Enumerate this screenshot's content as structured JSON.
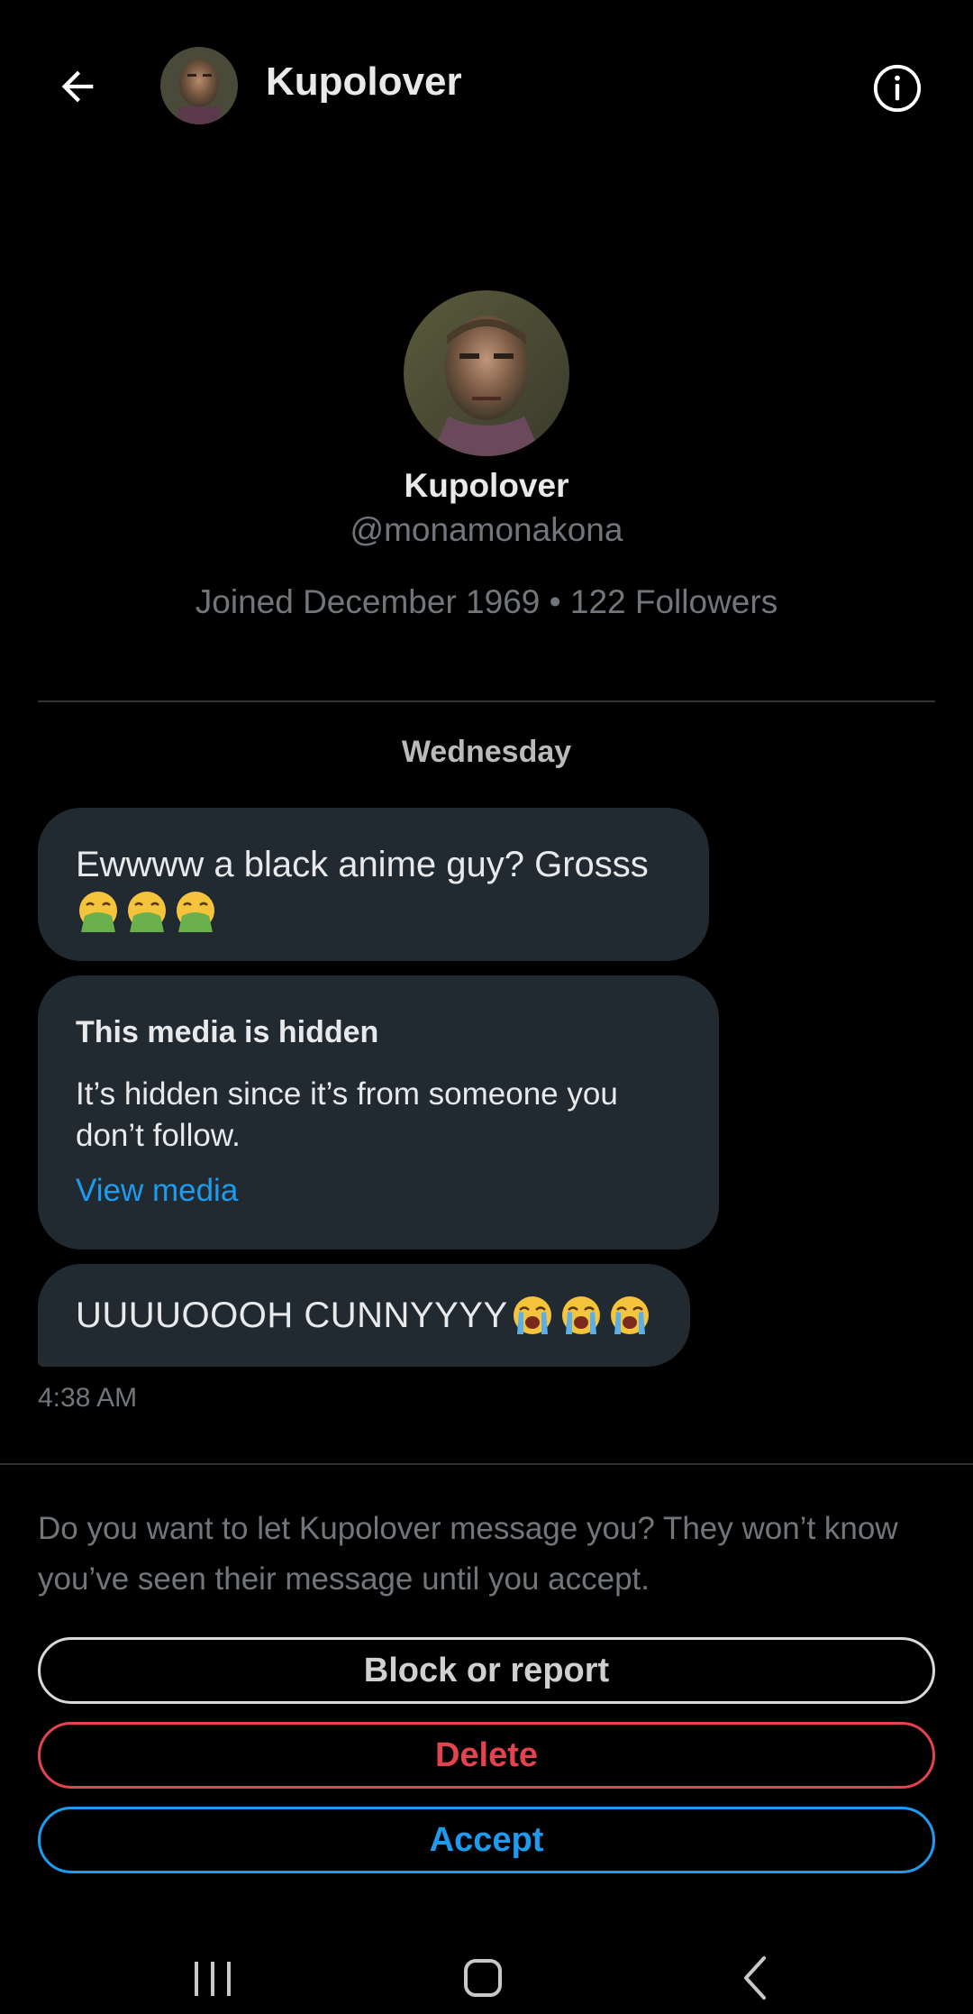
{
  "header": {
    "title": "Kupolover",
    "back_icon": "arrow-left-icon",
    "info_icon": "info-circle-icon"
  },
  "profile": {
    "name": "Kupolover",
    "handle": "@monamonakona",
    "meta": "Joined December 1969 • 122 Followers"
  },
  "conversation": {
    "day_label": "Wednesday",
    "messages": [
      {
        "text": "Ewwww a black anime guy? Grosss",
        "emoji": [
          "vomiting-face",
          "vomiting-face",
          "vomiting-face"
        ]
      },
      {
        "media_title": "This media is hidden",
        "media_desc": "It’s hidden since it’s from someone you don’t follow.",
        "media_link": "View media"
      },
      {
        "text": "UUUUOOOH CUNNYYYY",
        "emoji": [
          "loudly-crying-face",
          "loudly-crying-face",
          "loudly-crying-face"
        ]
      }
    ],
    "timestamp": "4:38 AM"
  },
  "request": {
    "prompt": "Do you want to let Kupolover message you? They won’t know you’ve seen their message until you accept.",
    "block_label": "Block or report",
    "delete_label": "Delete",
    "accept_label": "Accept"
  },
  "colors": {
    "background": "#000000",
    "bubble": "#222a31",
    "accent_blue": "#1d9bf0",
    "danger_red": "#e3434f",
    "muted_text": "#71767b"
  }
}
